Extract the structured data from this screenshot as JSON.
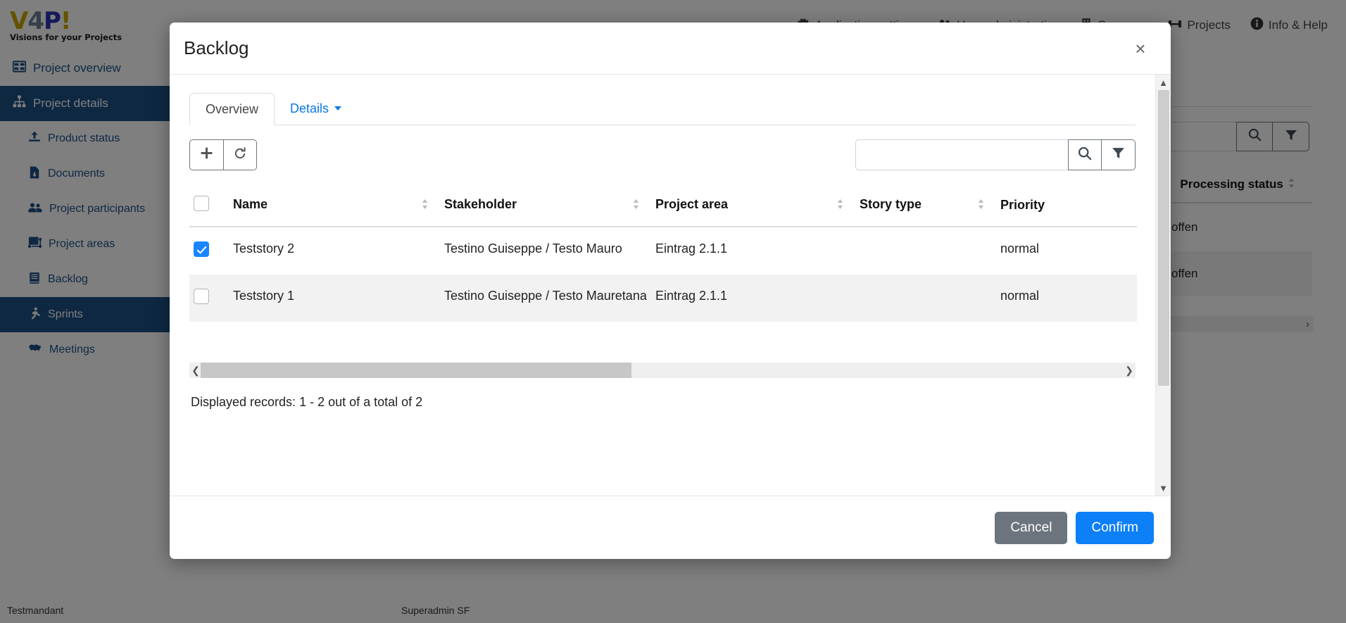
{
  "brand": {
    "logo_main_v": "V",
    "logo_main_4": "4",
    "logo_main_p": "P",
    "logo_main_bang": "!",
    "tagline": "Visions for your Projects"
  },
  "topnav": {
    "items": [
      {
        "label": "Application settings",
        "icon": "gear-icon"
      },
      {
        "label": "User administration",
        "icon": "users-icon"
      },
      {
        "label": "Company",
        "icon": "building-icon"
      },
      {
        "label": "Projects",
        "icon": "projects-icon"
      },
      {
        "label": "Info & Help",
        "icon": "info-icon"
      }
    ]
  },
  "sidebar": {
    "items": [
      {
        "label": "Project overview",
        "icon": "grid-icon",
        "level": 0,
        "active": false
      },
      {
        "label": "Project details",
        "icon": "sitemap-icon",
        "level": 0,
        "active": true
      },
      {
        "label": "Product status",
        "icon": "upload-icon",
        "level": 1,
        "active": false
      },
      {
        "label": "Documents",
        "icon": "document-icon",
        "level": 1,
        "active": false
      },
      {
        "label": "Project participants",
        "icon": "people-icon",
        "level": 1,
        "active": false
      },
      {
        "label": "Project areas",
        "icon": "areas-icon",
        "level": 1,
        "active": false
      },
      {
        "label": "Backlog",
        "icon": "book-icon",
        "level": 1,
        "active": false
      },
      {
        "label": "Sprints",
        "icon": "runner-icon",
        "level": 1,
        "active": true
      },
      {
        "label": "Meetings",
        "icon": "handshake-icon",
        "level": 1,
        "active": false
      }
    ]
  },
  "background_page": {
    "search_placeholder": "",
    "search_value": "",
    "columns": [
      "Processing status"
    ],
    "rows": [
      {
        "processing_status": "offen"
      },
      {
        "processing_status": "offen"
      }
    ],
    "records_text": "Displayed records: 1 - 2 out of a total of 2"
  },
  "statusbar": {
    "tenant": "Testmandant",
    "user": "Superadmin SF"
  },
  "modal": {
    "title": "Backlog",
    "close_label": "×",
    "tabs": [
      {
        "label": "Overview",
        "active": true,
        "has_caret": false
      },
      {
        "label": "Details",
        "active": false,
        "has_caret": true
      }
    ],
    "toolbar": {
      "add_label": "+",
      "refresh_label": "⟳",
      "search_value": "",
      "search_placeholder": ""
    },
    "table": {
      "columns": [
        {
          "label": "",
          "key": "checkbox",
          "sortable": false
        },
        {
          "label": "Name",
          "key": "name",
          "sortable": true
        },
        {
          "label": "Stakeholder",
          "key": "stakeholder",
          "sortable": true
        },
        {
          "label": "Project area",
          "key": "project_area",
          "sortable": true
        },
        {
          "label": "Story type",
          "key": "story_type",
          "sortable": true
        },
        {
          "label": "Priority",
          "key": "priority",
          "sortable": false
        }
      ],
      "rows": [
        {
          "selected": true,
          "name": "Teststory 2",
          "stakeholder": "Testino Guiseppe / Testo Mauro",
          "project_area": "Eintrag 2.1.1",
          "story_type": "",
          "priority": "normal"
        },
        {
          "selected": false,
          "name": "Teststory 1",
          "stakeholder": "Testino Guiseppe / Testo Mauretana",
          "project_area": "Eintrag 2.1.1",
          "story_type": "",
          "priority": "normal"
        }
      ]
    },
    "records_text": "Displayed records: 1 - 2 out of a total of 2",
    "footer": {
      "cancel_label": "Cancel",
      "confirm_label": "Confirm"
    }
  },
  "colors": {
    "sidebar_active": "#1c5085",
    "link_blue": "#0a7ae8",
    "primary_blue": "#0d7ff7",
    "secondary_gray": "#6c757d",
    "checkbox_blue": "#1a85ff"
  }
}
